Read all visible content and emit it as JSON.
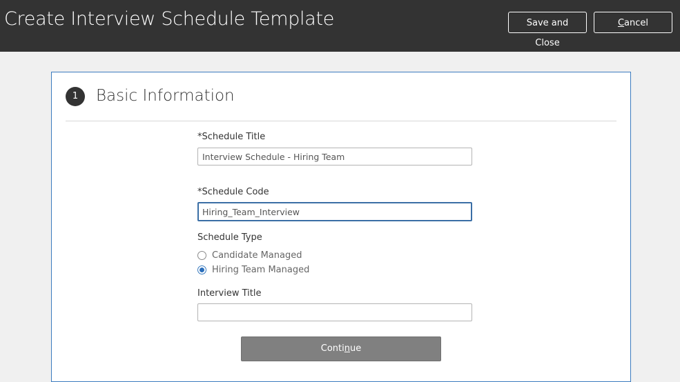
{
  "header": {
    "title": "Create Interview Schedule Template",
    "save_close_label": "Save and Close",
    "cancel_label": {
      "pre": "",
      "mnemonic": "C",
      "post": "ancel"
    }
  },
  "section": {
    "step_number": "1",
    "title": "Basic Information"
  },
  "form": {
    "required_marker": "*",
    "schedule_title": {
      "label": "Schedule Title",
      "value": "Interview Schedule - Hiring Team"
    },
    "schedule_code": {
      "label": "Schedule Code",
      "value": "Hiring_Team_Interview"
    },
    "schedule_type": {
      "label": "Schedule Type",
      "options": [
        "Candidate Managed",
        "Hiring Team Managed"
      ],
      "selected": "Hiring Team Managed"
    },
    "interview_title": {
      "label": "Interview Title",
      "value": ""
    },
    "continue_label": {
      "pre": "Conti",
      "mnemonic": "n",
      "post": "ue"
    }
  },
  "colors": {
    "header_bg": "#333333",
    "accent": "#3a7bbf",
    "button_gray": "#808080"
  }
}
